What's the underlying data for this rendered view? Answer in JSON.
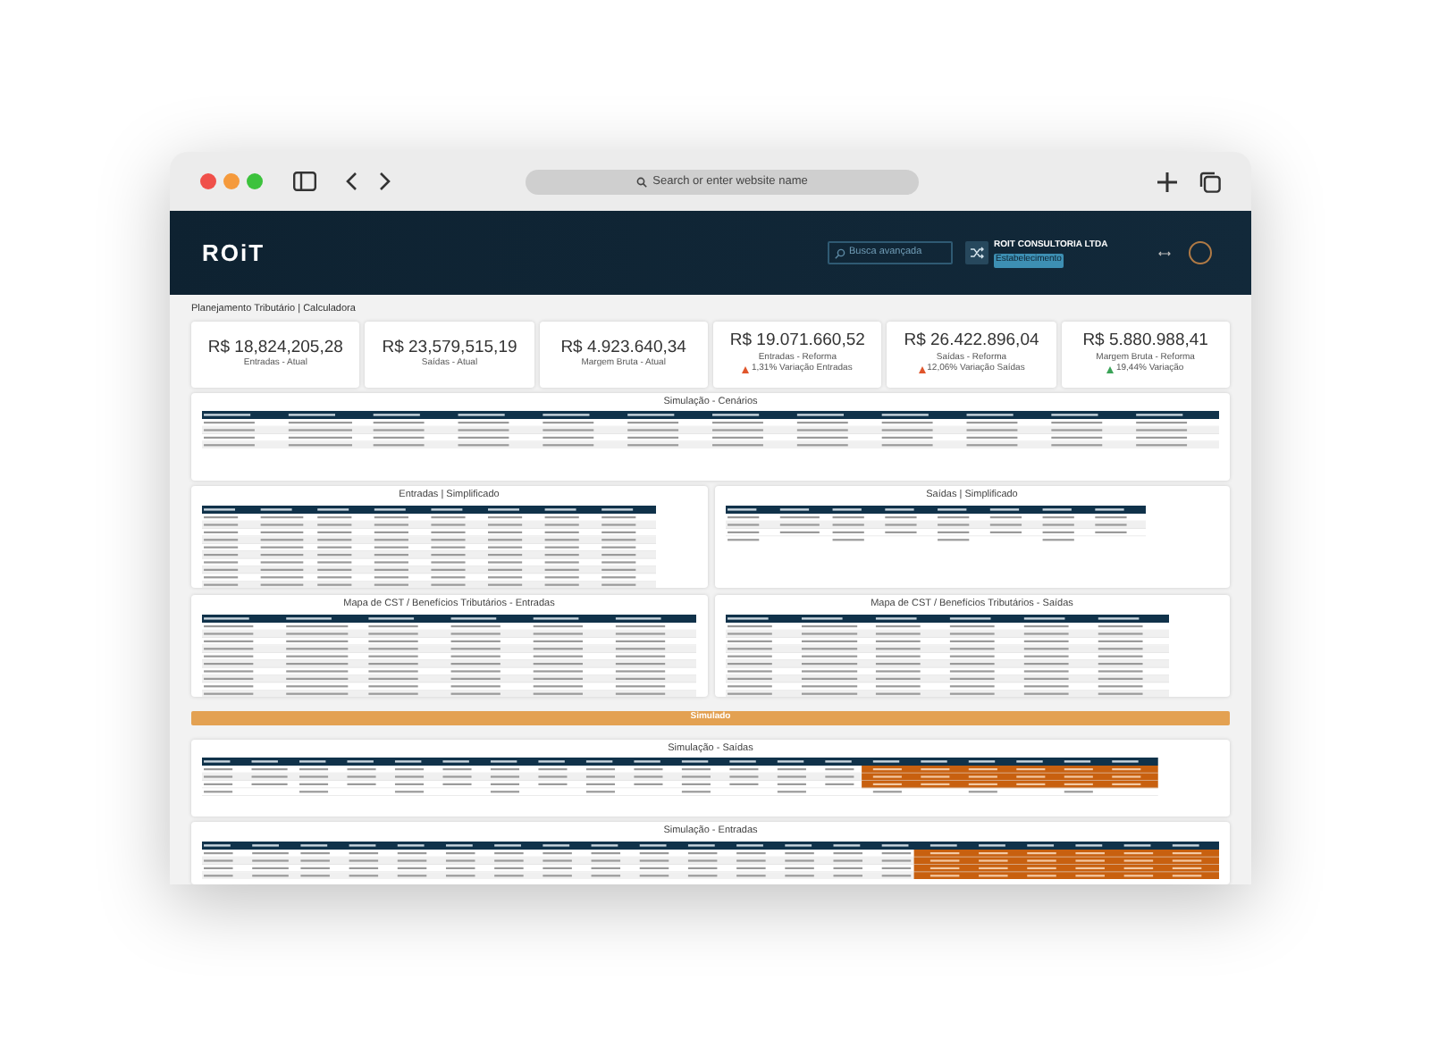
{
  "browser": {
    "address_placeholder": "Search or enter website name"
  },
  "header": {
    "logo": "ROiT",
    "search_placeholder": "Busca avançada",
    "company": "ROIT CONSULTORIA LTDA",
    "establishment": "Estabelecimento"
  },
  "page": {
    "title": "Planejamento Tributário | Calculadora"
  },
  "kpis": [
    {
      "value": "R$ 18,824,205,28",
      "label": "Entradas - Atual"
    },
    {
      "value": "R$ 23,579,515,19",
      "label": "Saídas - Atual"
    },
    {
      "value": "R$ 4.923.640,34",
      "label": "Margem Bruta - Atual"
    },
    {
      "value": "R$ 19.071.660,52",
      "label": "Entradas - Reforma",
      "change": {
        "text": "1,31% Variação Entradas",
        "color": "#e0552b"
      }
    },
    {
      "value": "R$ 26.422.896,04",
      "label": "Saídas - Reforma",
      "change": {
        "text": "12,06% Variação Saídas",
        "color": "#e0552b"
      }
    },
    {
      "value": "R$ 5.880.988,41",
      "label": "Margem Bruta - Reforma",
      "change": {
        "text": "19,44% Variação",
        "color": "#3aa357"
      }
    }
  ],
  "scenarios": {
    "title": "Simulação - Cenários"
  },
  "entradas_simplificado": {
    "title": "Entradas | Simplificado"
  },
  "saidas_simplificado": {
    "title": "Saídas | Simplificado"
  },
  "mapa_entradas": {
    "title": "Mapa de CST / Benefícios Tributários - Entradas"
  },
  "mapa_saidas": {
    "title": "Mapa de CST / Benefícios Tributários - Saídas"
  },
  "simulate_button": "Simulado",
  "simulacao_saidas": {
    "title": "Simulação - Saídas"
  },
  "simulacao_entradas": {
    "title": "Simulação - Entradas"
  }
}
